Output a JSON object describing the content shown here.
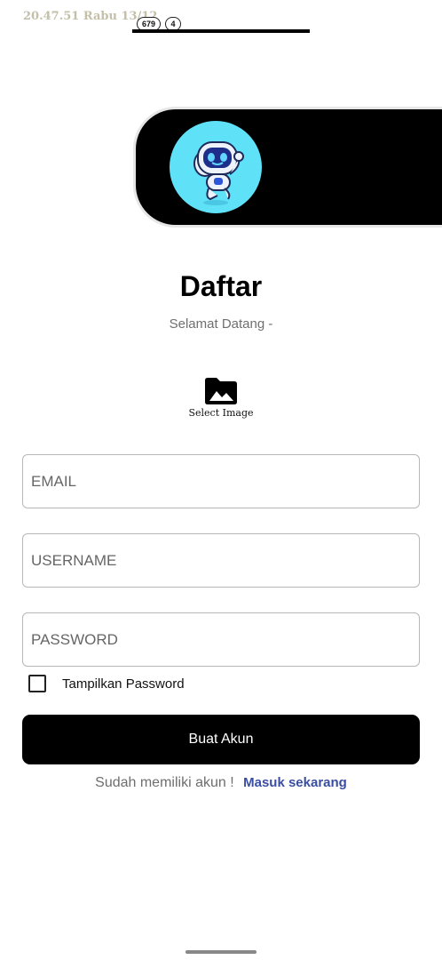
{
  "status_bar": {
    "time_date": "20.47.51 Rabu 13/12",
    "badge_1": "679",
    "badge_2": "4"
  },
  "header": {
    "logo_icon": "robot-mascot-icon",
    "logo_bg": "#5fe1f7"
  },
  "page": {
    "title": "Daftar",
    "subtitle": "Selamat Datang -"
  },
  "image_picker": {
    "icon": "image-folder-icon",
    "label": "Select Image"
  },
  "form": {
    "email_placeholder": "EMAIL",
    "username_placeholder": "USERNAME",
    "password_placeholder": "PASSWORD",
    "show_password_label": "Tampilkan Password",
    "show_password_checked": false,
    "submit_label": "Buat Akun"
  },
  "footer": {
    "prompt": "Sudah memiliki akun !",
    "login_link": "Masuk sekarang",
    "link_color": "#3a4ea1"
  }
}
